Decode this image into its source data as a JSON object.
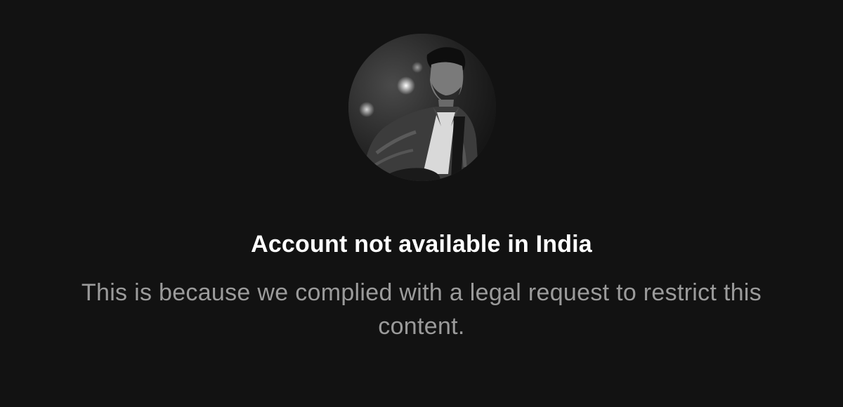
{
  "profile": {
    "avatar_icon": "profile-photo"
  },
  "notice": {
    "title": "Account not available in India",
    "message": "This is because we complied with a legal request to restrict this content."
  },
  "colors": {
    "background": "#121212",
    "title": "#ffffff",
    "message": "#9b9b9b"
  }
}
